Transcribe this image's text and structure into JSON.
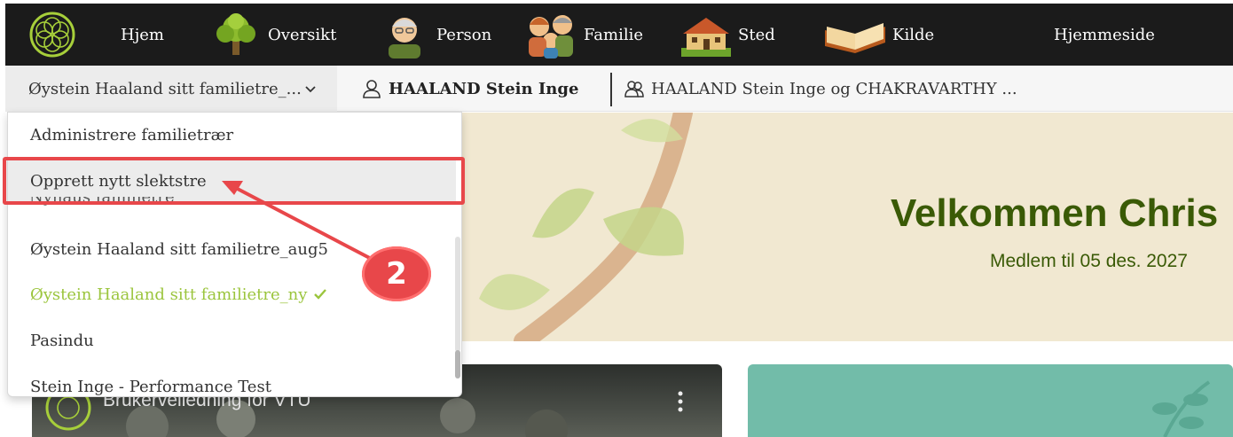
{
  "nav": {
    "items": [
      {
        "label": "Hjem",
        "icon": "home-logo-icon"
      },
      {
        "label": "Oversikt",
        "icon": "tree-icon"
      },
      {
        "label": "Person",
        "icon": "grandpa-icon"
      },
      {
        "label": "Familie",
        "icon": "family-icon"
      },
      {
        "label": "Sted",
        "icon": "house-icon"
      },
      {
        "label": "Kilde",
        "icon": "book-icon"
      },
      {
        "label": "Hjemmeside",
        "icon": ""
      }
    ]
  },
  "subbar": {
    "tree_select": "Øystein Haaland sitt familietre_...",
    "home_person": "HAALAND Stein Inge",
    "family": "HAALAND Stein Inge og CHAKRAVARTHY ..."
  },
  "dropdown": {
    "items": [
      {
        "label": "Administrere familietrær"
      },
      {
        "label": "Opprett nytt slektstre"
      },
      {
        "label": "Nyhaus familietre"
      },
      {
        "label": "Øystein Haaland sitt familietre_aug5"
      },
      {
        "label": "Øystein Haaland sitt familietre_ny"
      },
      {
        "label": "Pasindu"
      },
      {
        "label": "Stein Inge - Performance Test"
      }
    ]
  },
  "banner": {
    "welcome": "Velkommen Chris",
    "member": "Medlem til 05 des. 2027"
  },
  "video": {
    "title": "Brukerveiledning for VTU"
  },
  "annotation": {
    "step": "2",
    "color": "#e8474a"
  },
  "colors": {
    "accent_green": "#9bc53d",
    "welcome_green": "#3a5a06",
    "nav_bg": "#1b1b1b"
  }
}
